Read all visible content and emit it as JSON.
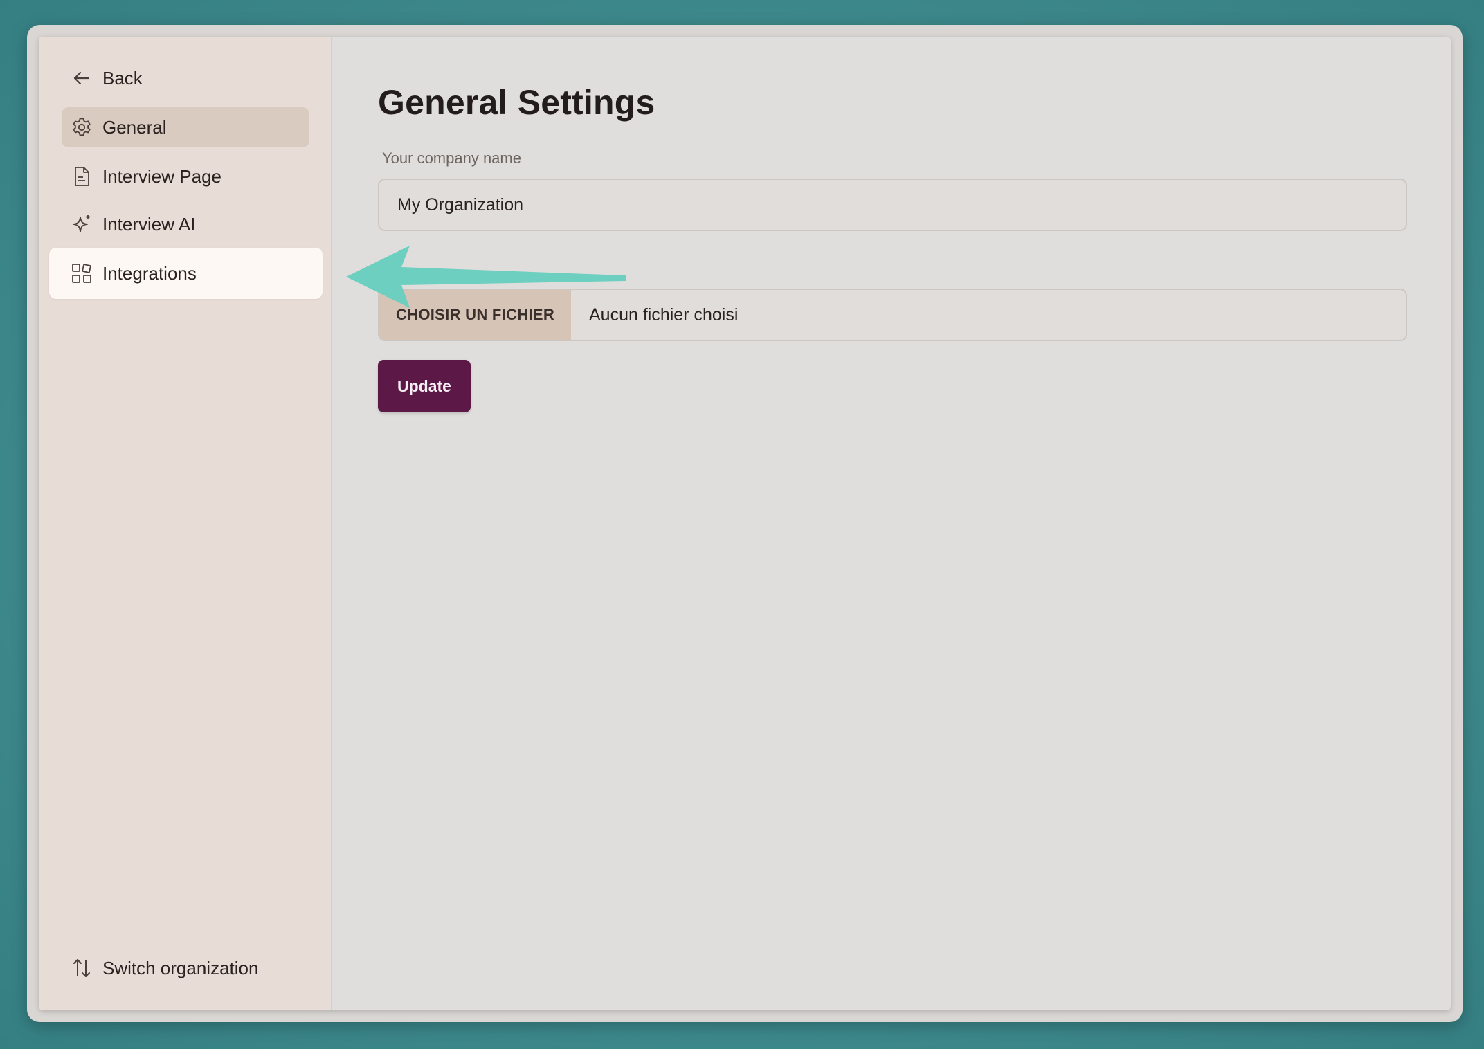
{
  "sidebar": {
    "back_label": "Back",
    "items": [
      {
        "label": "General",
        "icon": "gear-icon"
      },
      {
        "label": "Interview Page",
        "icon": "document-icon"
      },
      {
        "label": "Interview AI",
        "icon": "sparkle-icon"
      },
      {
        "label": "Integrations",
        "icon": "grid-icon"
      }
    ],
    "switch_label": "Switch organization"
  },
  "main": {
    "title": "General Settings",
    "company_label": "Your company name",
    "company_value": "My Organization",
    "logo_label": "",
    "file_button_label": "CHOISIR UN FICHIER",
    "file_status": "Aucun fichier choisi",
    "update_label": "Update"
  },
  "colors": {
    "accent": "#5c1846",
    "annotation_arrow": "#6ccfbf",
    "sidebar_bg": "#e8ddd6",
    "main_bg": "#e0dedc"
  }
}
